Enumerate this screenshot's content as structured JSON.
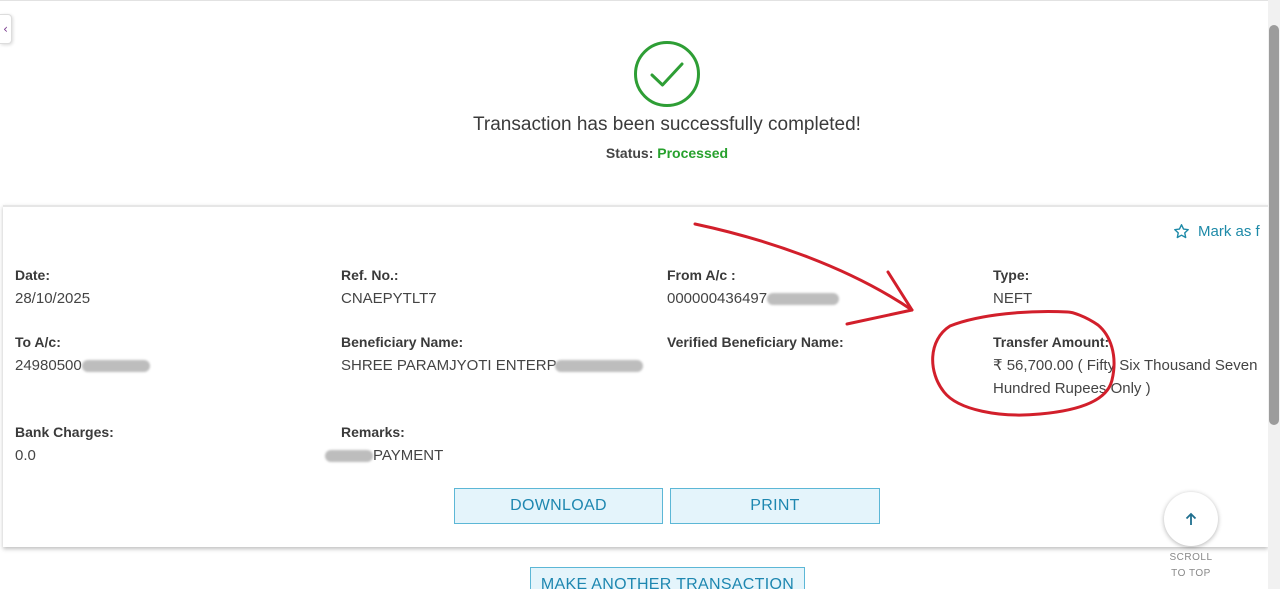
{
  "success": {
    "message": "Transaction has been successfully completed!",
    "status_label": "Status:",
    "status_value": "Processed",
    "status_color": "#27a12d"
  },
  "card": {
    "favorite_label": "Mark as f"
  },
  "fields": {
    "date": {
      "label": "Date:",
      "value": "28/10/2025"
    },
    "ref_no": {
      "label": "Ref. No.:",
      "value": "CNAEPYTLT7"
    },
    "from_ac": {
      "label": "From A/c :",
      "value": "000000436497"
    },
    "type": {
      "label": "Type:",
      "value": "NEFT"
    },
    "to_ac": {
      "label": "To A/c:",
      "value": "24980500"
    },
    "beneficiary": {
      "label": "Beneficiary Name:",
      "value": "SHREE PARAMJYOTI ENTERP"
    },
    "verified_beneficiary": {
      "label": "Verified Beneficiary Name:",
      "value": ""
    },
    "amount": {
      "label": "Transfer Amount:",
      "value": "₹ 56,700.00 ( Fifty Six Thousand Seven Hundred Rupees Only )"
    },
    "bank_charges": {
      "label": "Bank Charges:",
      "value": "0.0"
    },
    "remarks": {
      "label": "Remarks:",
      "value": "PAYMENT"
    }
  },
  "buttons": {
    "download": "DOWNLOAD",
    "print": "PRINT",
    "make_another": "MAKE ANOTHER TRANSACTION"
  },
  "scroll_to_top": {
    "line1": "SCROLL",
    "line2": "TO TOP"
  },
  "icons": {
    "success": "check-circle-icon",
    "favorite": "star-outline-icon",
    "scroll_top": "arrow-up-icon",
    "collapse": "chevron-left-icon"
  },
  "colors": {
    "accent": "#1e8aa8",
    "success_green": "#27a12d",
    "annotation_red": "#d21f2b"
  }
}
